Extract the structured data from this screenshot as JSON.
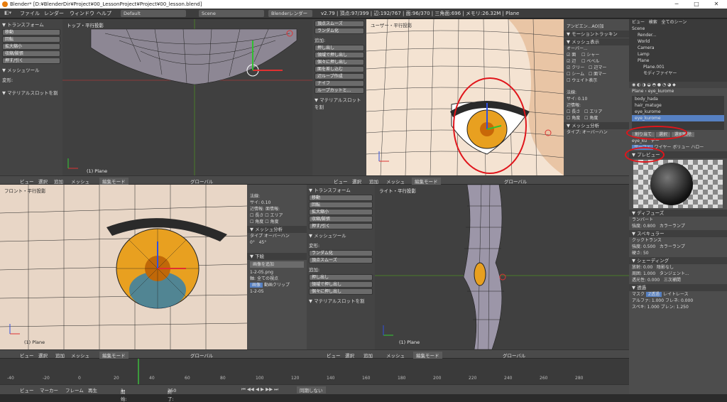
{
  "titlebar": {
    "text": "Blender* [D:¥BlenderDir¥Project¥00_LessonProject¥Project¥00_lesson.blend]",
    "min": "─",
    "max": "□",
    "close": "✕"
  },
  "menu": {
    "file": "ファイル",
    "render": "レンダー",
    "window": "ウィンドウ",
    "help": "ヘルプ",
    "layout": "Default",
    "scene": "Scene",
    "engine": "Blenderレンダー",
    "stats": "v2.79 | 頂点:97/399 | 辺:192/767 | 面:96/370 | 三角面:696 | メモリ:26.32M | Plane"
  },
  "toolshelf": {
    "transform": "▼ トランスフォーム",
    "move": "移動",
    "rotate": "回転",
    "scale": "拡大縮小",
    "shrink": "収縮/膨張",
    "push": "押す/引く",
    "meshtools": "▼ メッシュツール",
    "deform": "変形:",
    "material": "▼ マテリアルスロットを割"
  },
  "toolshelf2": {
    "smooth": "頂点スムーズ",
    "random": "ランダム化",
    "add": "追加:",
    "extrude": "押し出し",
    "extrude_region": "領域で押し出し",
    "extrude_each": "個々に押し出し",
    "cut": "面を差し込む",
    "loop": "辺ループ作成",
    "knife": "ナイフ",
    "loopcut": "ループカットと...",
    "material": "▼ マテリアルスロットを割"
  },
  "viewports": {
    "top": "トップ・平行投影",
    "user": "ユーザー・平行投影",
    "front": "フロント・平行投影",
    "right": "ライト・平行投影",
    "obj": "(1) Plane"
  },
  "vbar": {
    "view": "ビュー",
    "select": "選択",
    "add": "追加",
    "mesh": "メッシュ",
    "mode": "編集モード",
    "global": "グローバル"
  },
  "npanel": {
    "ambient": "アンビエン...AO)加",
    "motion": "▼ モーショントラッキン",
    "meshdisplay": "▼ メッシュ表示",
    "overlay": "オーバー...",
    "face": "面",
    "edge": "辺",
    "crease": "クリー",
    "seam": "シーム",
    "weight": "ウェイト表示",
    "shade": "シャー",
    "bevel": "ベベル",
    "edgemark": "辺マー",
    "facemark": "面マー",
    "normal": "法線:",
    "size": "サイ: 0.10",
    "edgeinfo": "辺情報:",
    "faceinfo": "面情報:",
    "length": "長さ",
    "angle": "角度",
    "area": "エリア",
    "angle2": "角度",
    "analysis": "▼ メッシュ分析",
    "type": "タイプ:",
    "overhang": "オーバーハン"
  },
  "npanel2": {
    "normal": "法線:",
    "size": "サイ: 0.10",
    "edgeinfo": "辺情報:",
    "faceinfo": "面情報:",
    "length": "長さ",
    "area": "エリア",
    "angle": "角度",
    "angle2": "角度",
    "analysis": "▼ メッシュ分析",
    "type": "タイプ",
    "overhang": "オーバーハン",
    "zero": "0°",
    "deg": "45°",
    "bg": "▼ 下絵",
    "addimg": "画像を追加",
    "img": "1-2-05.png",
    "axis": "軸:",
    "view": "全ての視点",
    "image": "画像",
    "clip": "動画クリップ",
    "imgname": "1-2-05"
  },
  "outliner": {
    "view": "ビュー",
    "search": "検索",
    "allscenes": "全てのシーン",
    "scene": "Scene",
    "layers": "Render...",
    "world": "World",
    "camera": "Camera",
    "lamp": "Lamp",
    "plane": "Plane",
    "planeobj": "Plane.001",
    "modifier": "モディファイヤー"
  },
  "material": {
    "plane": "Plane",
    "eye": "eye_kurome",
    "slots": [
      "body_hada",
      "hair_matuge",
      "eye_kurome",
      "eye_kurome"
    ],
    "assign": "割り当て",
    "select": "選択",
    "deselect": "選択解除",
    "matname": "eye_ku",
    "data": "デー",
    "surface": "サーフェ",
    "wire": "ワイヤー",
    "volume": "ボリュー",
    "halo": "ハロー",
    "preview": "▼ プレビュー",
    "diffuse": "▼ ディフューズ",
    "lambert": "ランバート",
    "intensity": "強度:",
    "intval": "0.800",
    "ramp": "カラーランプ",
    "specular": "▼ スペキュラー",
    "cooktorr": "クックトランス",
    "specint": "0.500",
    "hard": "硬さ:",
    "hardval": "50",
    "shading": "▼ シェーディング",
    "emit": "放射:",
    "emitval": "0.00",
    "shadeless": "陰影なし",
    "ambient": "周囲:",
    "ambval": "1.000",
    "tangent": "タンジェント...",
    "translucency": "透光性:",
    "transval": "0.000",
    "cubic": "三次補間",
    "transparency": "▼ 透過",
    "mask": "マスク",
    "ztrans": "Z透過",
    "raytrace": "レイトレース",
    "alpha": "アルファ:",
    "alphaval": "1.000",
    "fresnel": "フレネ:",
    "fresnelval": "0.000",
    "specular2": "スペキ:",
    "spec2val": "1.000",
    "blend": "ブレン:",
    "blendval": "1.250"
  },
  "timeline": {
    "view": "ビュー",
    "marker": "マーカー",
    "frame": "フレーム",
    "play": "再生",
    "start": "開始:",
    "startval": "1",
    "end": "終了:",
    "endval": "250",
    "sync": "同期しない",
    "ticks": [
      "-40",
      "-20",
      "0",
      "20",
      "40",
      "60",
      "80",
      "100",
      "120",
      "140",
      "160",
      "180",
      "200",
      "220",
      "240",
      "260",
      "280"
    ]
  }
}
